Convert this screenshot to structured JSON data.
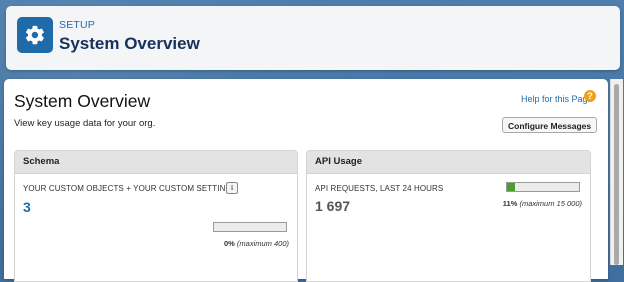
{
  "header": {
    "breadcrumb": "SETUP",
    "title": "System Overview",
    "icon": "gear-icon",
    "icon_bg": "#1f6ba9"
  },
  "page": {
    "title": "System Overview",
    "description": "View key usage data for your org.",
    "help_link": "Help for this Page",
    "configure_button": "Configure Messages"
  },
  "schema_panel": {
    "heading": "Schema",
    "metric_label": "YOUR CUSTOM OBJECTS + YOUR CUSTOM SETTINGS",
    "info_icon_glyph": "i",
    "value": "3",
    "percent_text": "0%",
    "maximum_text": "(maximum 400)",
    "fill_fraction": 0.0
  },
  "api_panel": {
    "heading": "API Usage",
    "metric_label": "API REQUESTS, LAST 24 HOURS",
    "value": "1 697",
    "percent_text": "11%",
    "maximum_text": "(maximum 15 000)",
    "fill_fraction": 0.11,
    "fill_color": "#4aa02c"
  }
}
